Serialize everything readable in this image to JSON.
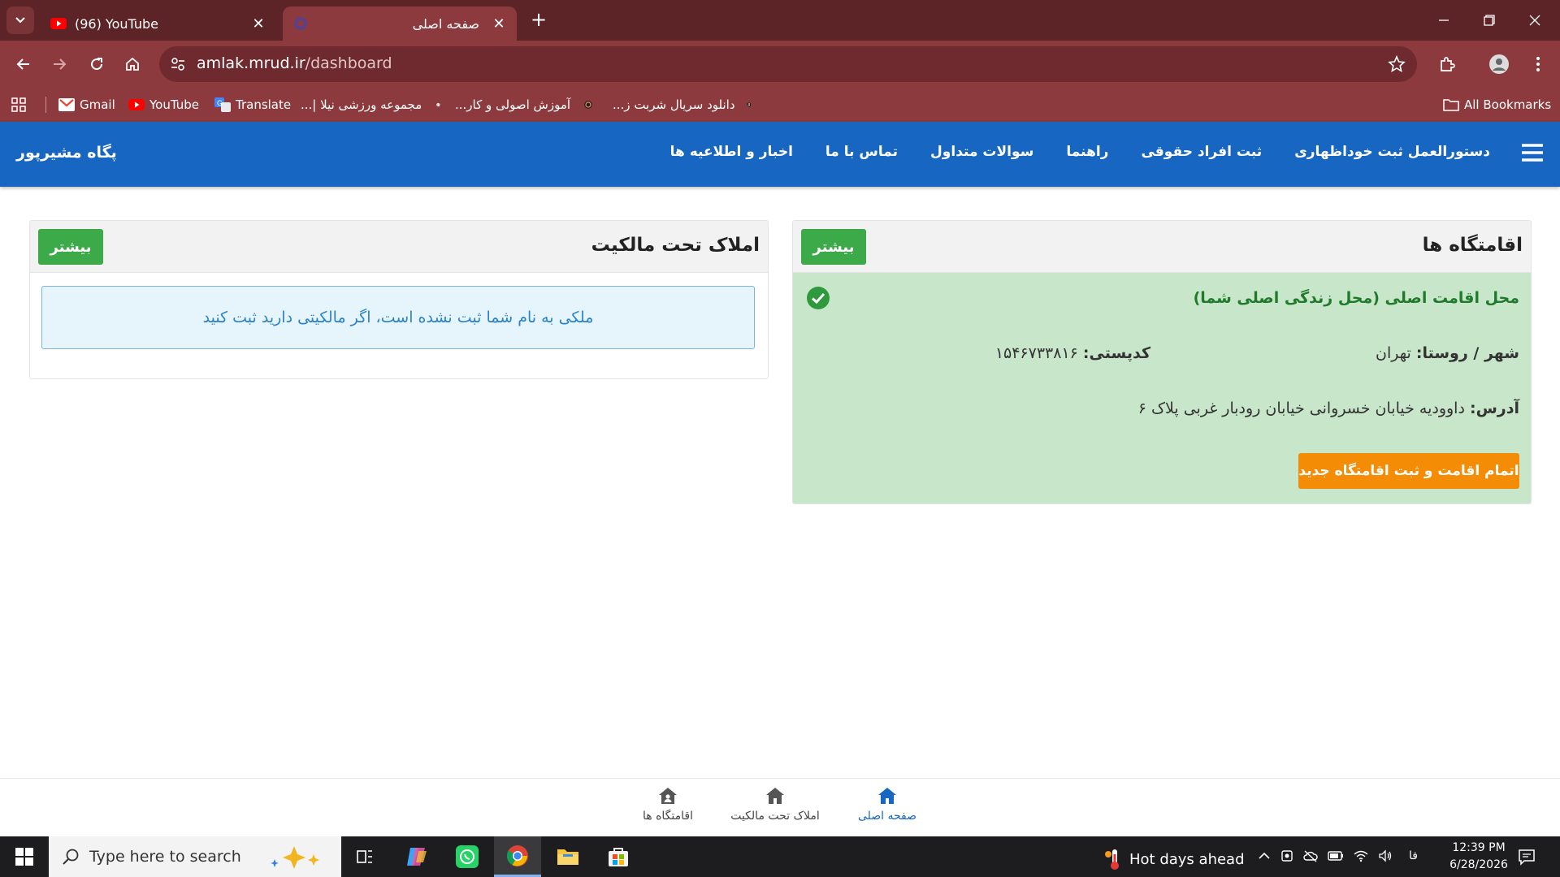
{
  "browser": {
    "tabs": [
      {
        "title": "(96) YouTube",
        "active": false
      },
      {
        "title": "صفحه اصلی",
        "active": true
      }
    ],
    "omnibox": {
      "domain": "amlak.mrud.ir",
      "path": "/dashboard"
    },
    "bookmarks": [
      {
        "label": "Gmail",
        "icon": "gmail-icon"
      },
      {
        "label": "YouTube",
        "icon": "youtube-icon"
      },
      {
        "label": "Translate",
        "icon": "translate-icon"
      },
      {
        "label": "مجموعه ورزشی نیلا |...",
        "icon": "globe-icon"
      },
      {
        "label": "آموزش اصولی و کار...",
        "icon": "site-icon"
      },
      {
        "label": "دانلود سریال شربت ز...",
        "icon": "music-icon"
      }
    ],
    "all_bookmarks_label": "All Bookmarks"
  },
  "site": {
    "brand": "پگاه مشیرپور",
    "nav": [
      "اخبار و اطلاعیه ها",
      "تماس با ما",
      "سوالات متداول",
      "راهنما",
      "ثبت افراد حقوقی",
      "دستورالعمل ثبت خوداظهاری"
    ]
  },
  "residences": {
    "title": "اقامتگاه ها",
    "more_label": "بیشتر",
    "main_title": "محل اقامت اصلی (محل زندگی اصلی شما)",
    "city_label": "شهر / روستا:",
    "city_value": "تهران",
    "postal_label": "کدپستی:",
    "postal_value": "۱۵۴۶۷۳۳۸۱۶",
    "address_label": "آدرس:",
    "address_value": "داوودیه خیابان خسروانی خیابان رودبار غربی پلاک ۶",
    "finish_button": "اتمام اقامت و ثبت اقامتگاه جدید"
  },
  "properties": {
    "title": "املاک تحت مالکیت",
    "more_label": "بیشتر",
    "empty_message": "ملکی به نام شما ثبت نشده است، اگر مالکیتی دارید ثبت کنید"
  },
  "bottom_nav": [
    {
      "label": "صفحه اصلی",
      "active": true
    },
    {
      "label": "املاک تحت مالکیت",
      "active": false
    },
    {
      "label": "اقامتگاه ها",
      "active": false
    }
  ],
  "taskbar": {
    "search_placeholder": "Type here to search",
    "weather": "Hot days ahead",
    "lang": "فا",
    "time": "12:39 PM",
    "date": "6/28/2026"
  },
  "colors": {
    "header_blue": "#1766c2",
    "success_green": "#3daa4a",
    "residence_bg": "#c8e6c9",
    "orange": "#f48c05",
    "chrome_red": "#8c3a3e"
  }
}
